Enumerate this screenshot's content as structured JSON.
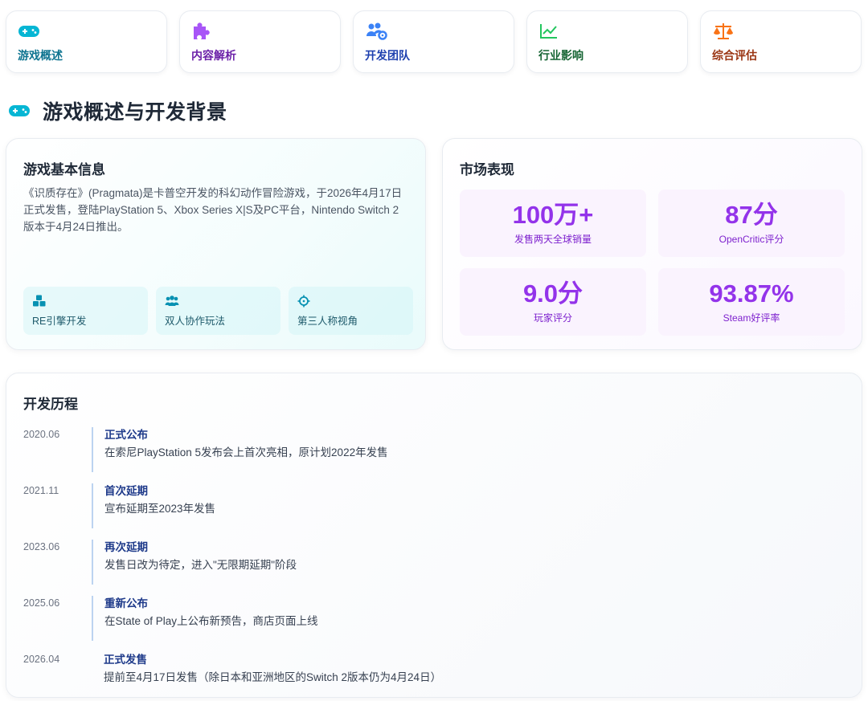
{
  "nav": [
    {
      "label": "游戏概述",
      "icon": "gamepad-icon",
      "color": "#0e7490",
      "icon_color": "#06b6d4"
    },
    {
      "label": "内容解析",
      "icon": "puzzle-piece-icon",
      "color": "#6b21a8",
      "icon_color": "#a855f7"
    },
    {
      "label": "开发团队",
      "icon": "users-gear-icon",
      "color": "#1e40af",
      "icon_color": "#3b82f6"
    },
    {
      "label": "行业影响",
      "icon": "chart-line-icon",
      "color": "#166534",
      "icon_color": "#22c55e"
    },
    {
      "label": "综合评估",
      "icon": "balance-scale-icon",
      "color": "#9a3412",
      "icon_color": "#f97316"
    }
  ],
  "section": {
    "title": "游戏概述与开发背景",
    "icon": "gamepad-icon",
    "icon_color": "#06b6d4"
  },
  "basic_info": {
    "title": "游戏基本信息",
    "description": "《识质存在》(Pragmata)是卡普空开发的科幻动作冒险游戏，于2026年4月17日正式发售，登陆PlayStation 5、Xbox Series X|S及PC平台，Nintendo Switch 2版本于4月24日推出。",
    "features": [
      {
        "label": "RE引擎开发",
        "icon": "cubes-icon"
      },
      {
        "label": "双人协作玩法",
        "icon": "users-icon"
      },
      {
        "label": "第三人称视角",
        "icon": "crosshairs-icon"
      }
    ],
    "accent": "#0891b2"
  },
  "market": {
    "title": "市场表现",
    "stats": [
      {
        "value": "100万+",
        "label": "发售两天全球销量"
      },
      {
        "value": "87分",
        "label": "OpenCritic评分"
      },
      {
        "value": "9.0分",
        "label": "玩家评分"
      },
      {
        "value": "93.87%",
        "label": "Steam好评率"
      }
    ],
    "accent": "#9333ea"
  },
  "history": {
    "title": "开发历程",
    "items": [
      {
        "date": "2020.06",
        "title": "正式公布",
        "text": "在索尼PlayStation 5发布会上首次亮相，原计划2022年发售"
      },
      {
        "date": "2021.11",
        "title": "首次延期",
        "text": "宣布延期至2023年发售"
      },
      {
        "date": "2023.06",
        "title": "再次延期",
        "text": "发售日改为待定，进入\"无限期延期\"阶段"
      },
      {
        "date": "2025.06",
        "title": "重新公布",
        "text": "在State of Play上公布新预告，商店页面上线"
      },
      {
        "date": "2026.04",
        "title": "正式发售",
        "text": "提前至4月17日发售（除日本和亚洲地区的Switch 2版本仍为4月24日）"
      }
    ]
  }
}
